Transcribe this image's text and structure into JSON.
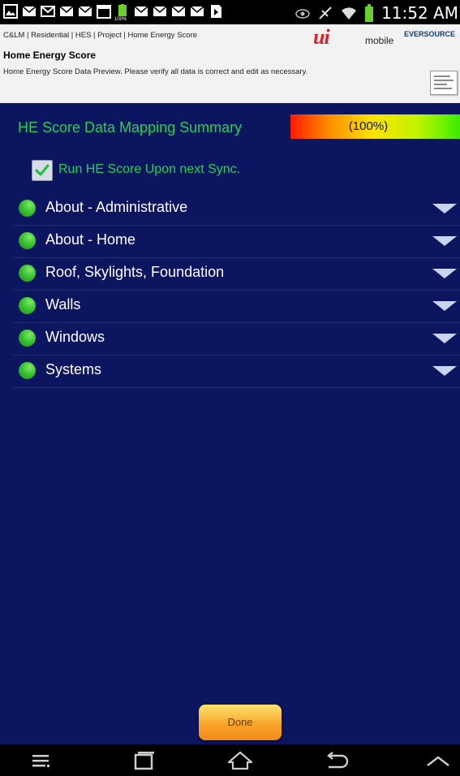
{
  "status_bar": {
    "time": "11:52 AM",
    "battery_small_label": "100%",
    "left_icons": [
      "gallery-icon",
      "mail-icon",
      "gmail-icon",
      "mail-icon",
      "mail-icon",
      "calendar-icon",
      "battery-full-icon",
      "mail-icon",
      "mail-icon",
      "mail-icon",
      "mail-icon",
      "media-play-icon"
    ],
    "right_icons": [
      "eye-icon",
      "vibrate-icon",
      "wifi-icon",
      "battery-icon"
    ]
  },
  "header": {
    "breadcrumb": "C&LM | Residential | HES | Project | Home Energy Score",
    "logo_ui": "ui",
    "logo_mobile": "mobile",
    "logo_brand": "EVERSOURCE",
    "title": "Home Energy Score",
    "description": "Home Energy Score Data Preview. Please verify all data is correct and edit as necessary."
  },
  "summary": {
    "title": "HE Score Data Mapping Summary",
    "progress_text": "(100%)",
    "progress_value": 1.0
  },
  "run_option": {
    "label": "Run HE Score Upon next Sync.",
    "checked": true
  },
  "sections": [
    {
      "label": "About - Administrative",
      "status": "complete"
    },
    {
      "label": "About - Home",
      "status": "complete"
    },
    {
      "label": "Roof, Skylights, Foundation",
      "status": "complete"
    },
    {
      "label": "Walls",
      "status": "complete"
    },
    {
      "label": "Windows",
      "status": "complete"
    },
    {
      "label": "Systems",
      "status": "complete"
    }
  ],
  "done_label": "Done",
  "nav_bar": [
    "menu-icon",
    "recent-apps-icon",
    "home-icon",
    "back-icon",
    "chevron-up-icon"
  ],
  "colors": {
    "background": "#0b1560",
    "accent_green": "#22d34a",
    "header_bg": "#f2f2f2",
    "button_orange": "#f8a126"
  }
}
